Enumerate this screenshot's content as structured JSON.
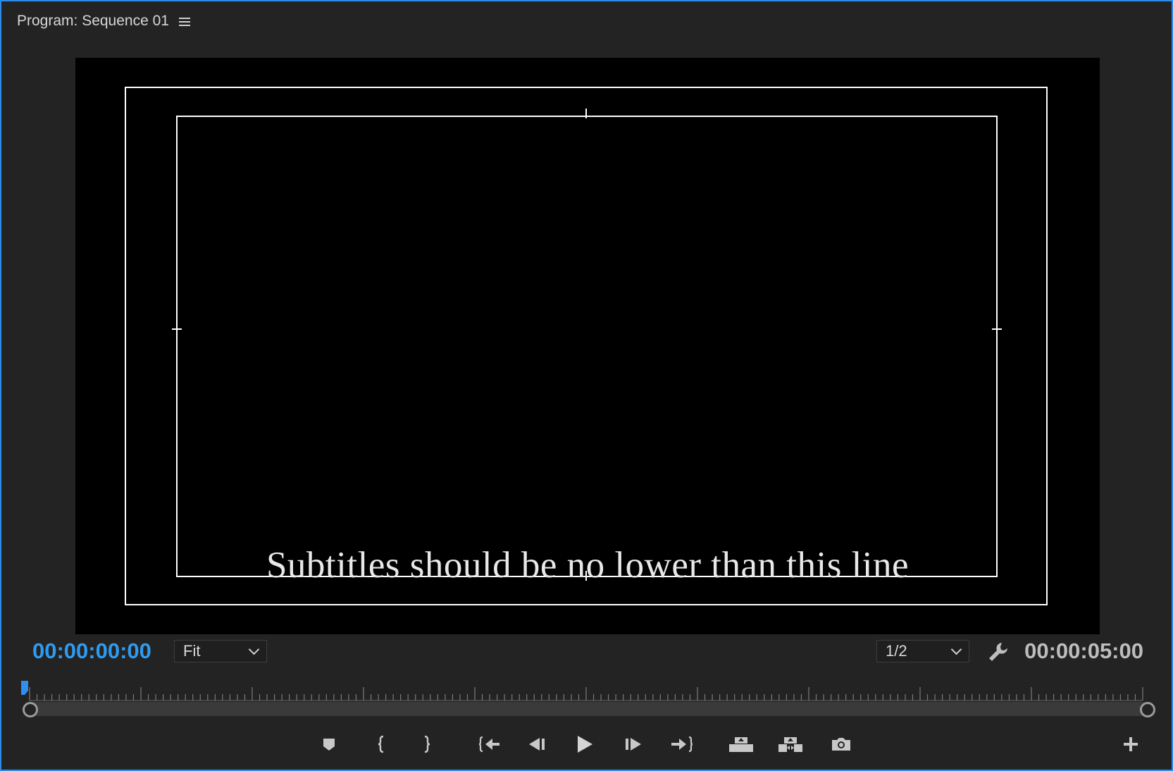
{
  "panel": {
    "title": "Program: Sequence 01",
    "accent_color": "#2d8ceb"
  },
  "monitor": {
    "overlay_text": "Subtitles should be no lower than this line",
    "guides": [
      "safe-action-margin",
      "safe-title-margin"
    ]
  },
  "controls": {
    "current_timecode": "00:00:00:00",
    "duration_timecode": "00:00:05:00",
    "zoom_selected": "Fit",
    "resolution_selected": "1/2",
    "timecode_color": "#2f9bf0"
  },
  "transport_buttons": [
    {
      "name": "add-marker",
      "icon": "marker-icon"
    },
    {
      "name": "mark-in",
      "icon": "mark-in-icon"
    },
    {
      "name": "mark-out",
      "icon": "mark-out-icon"
    },
    {
      "name": "go-to-in",
      "icon": "go-to-in-icon"
    },
    {
      "name": "step-back",
      "icon": "step-back-icon"
    },
    {
      "name": "play-stop",
      "icon": "play-icon"
    },
    {
      "name": "step-forward",
      "icon": "step-forward-icon"
    },
    {
      "name": "go-to-out",
      "icon": "go-to-out-icon"
    },
    {
      "name": "lift",
      "icon": "lift-icon"
    },
    {
      "name": "extract",
      "icon": "extract-icon"
    },
    {
      "name": "export-frame",
      "icon": "camera-icon"
    },
    {
      "name": "button-editor",
      "icon": "plus-icon"
    }
  ]
}
